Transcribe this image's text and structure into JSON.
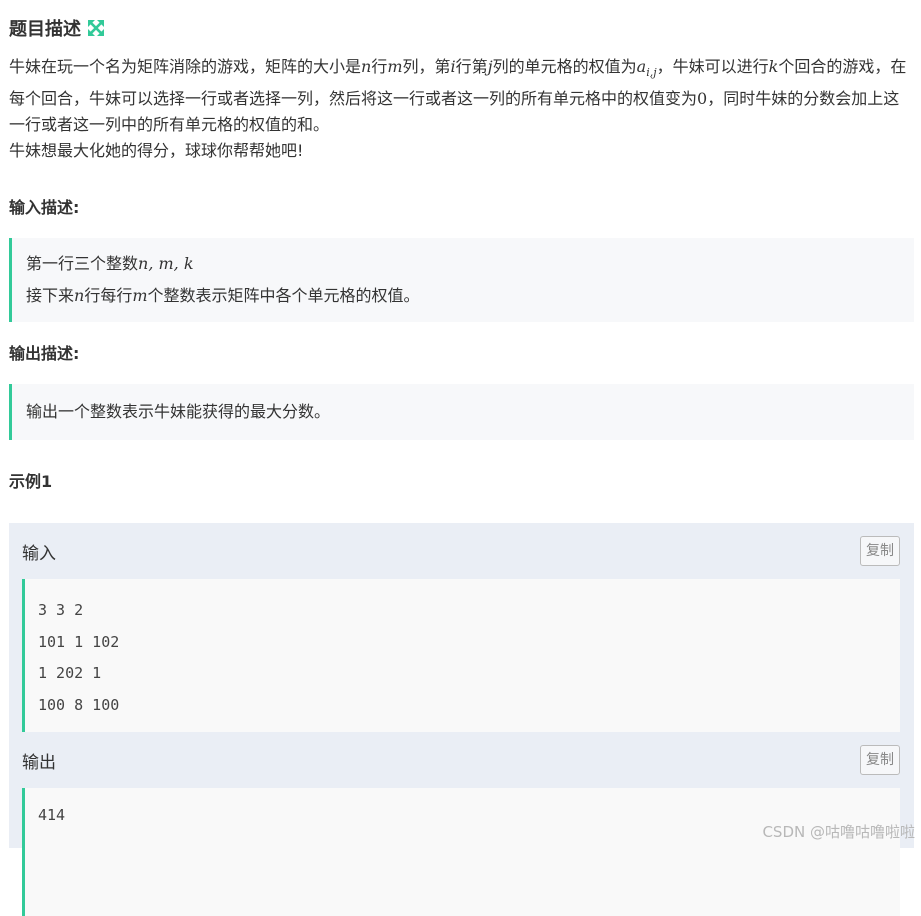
{
  "title": "题目描述",
  "description": {
    "p1_a": "牛妹在玩一个名为矩阵消除的游戏，矩阵的大小是",
    "var_n": "n",
    "p1_b": "行",
    "var_m": "m",
    "p1_c": "列，第",
    "var_i": "i",
    "p1_d": "行第",
    "var_j": "j",
    "p1_e": "列的单元格的权值为",
    "var_a": "a",
    "var_a_sub": "i,j",
    "p1_f": "，牛妹可以进行",
    "var_k": "k",
    "p1_g": "个回合的游戏，在每个回合，牛妹可以选择一行或者选择一列，然后将这一行或者这一列的所有单元格中的权值变为",
    "var_zero": "0",
    "p1_h": "，同时牛妹的分数会加上这一行或者这一列中的所有单元格的权值的和。",
    "p2": "牛妹想最大化她的得分，球球你帮帮她吧!"
  },
  "input_section": {
    "title": "输入描述:",
    "line1_text": "第一行三个整数",
    "line1_math": "n, m, k",
    "line2_a": "接下来",
    "line2_n": "n",
    "line2_b": "行每行",
    "line2_m": "m",
    "line2_c": "个整数表示矩阵中各个单元格的权值。"
  },
  "output_section": {
    "title": "输出描述:",
    "text": "输出一个整数表示牛妹能获得的最大分数。"
  },
  "example": {
    "title": "示例1",
    "input_label": "输入",
    "output_label": "输出",
    "copy_label": "复制",
    "input_lines": [
      "3 3 2",
      "101 1 102",
      "1 202 1",
      "100 8 100"
    ],
    "output_lines": [
      "414"
    ]
  },
  "watermark": "CSDN @咕噜咕噜啦啦",
  "colors": {
    "accent": "#32ca99",
    "example_bg": "#eaeef5"
  },
  "icons": {
    "title_icon": "expand-icon"
  }
}
